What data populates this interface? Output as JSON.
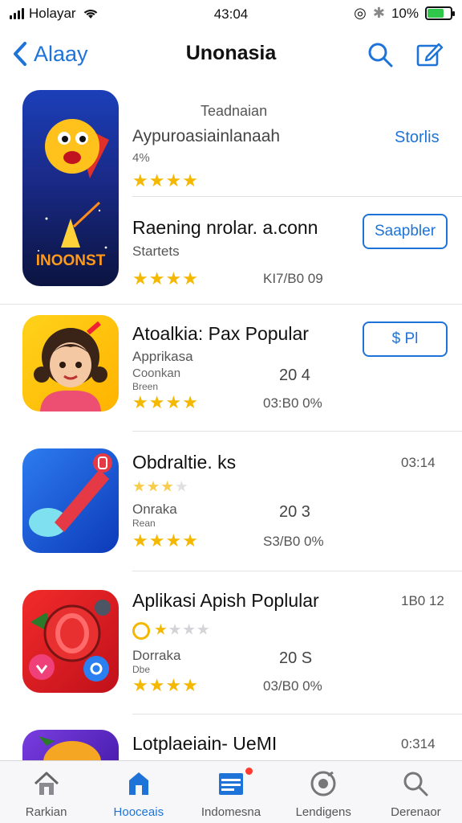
{
  "status_bar": {
    "carrier": "Holayar",
    "time": "43:04",
    "battery": "10%",
    "battery_level": 0.7
  },
  "nav": {
    "back_label": "Alaay",
    "title": "Unonasia",
    "search_icon": "search-icon",
    "edit_icon": "edit-icon"
  },
  "apps": [
    {
      "header": "Teadnaian",
      "title": "Aypuroasiainlanaah",
      "subtitle": "4%",
      "rating": 3.5,
      "action": "Storlis",
      "icon_text": ""
    },
    {
      "title": "Raening nrolar. a.conn",
      "subtitle": "Startets",
      "rating": 3.5,
      "meta": "KI7/B0 09",
      "button": "Saapbler",
      "icon_text": "INOONST"
    },
    {
      "title": "Atoalkia: Pax Popular",
      "subtitle": "Apprikasa",
      "small1": "Coonkan",
      "small2": "Breen",
      "number": "20 4",
      "rating": 3.5,
      "meta": "03:B0 0%",
      "button": "$ Pl"
    },
    {
      "title": "Obdraltie. ks",
      "right": "03:14",
      "stars_small": "3.0",
      "subtitle": "Onraka",
      "small1": "Rean",
      "number": "20 3",
      "rating": 3.5,
      "meta": "S3/B0 0%"
    },
    {
      "title": "Aplikasi Apish Poplular",
      "right": "1B0 12",
      "subtitle": "Dorraka",
      "small1": "Dbe",
      "number": "20 S",
      "rating": 3.5,
      "meta": "03/B0 0%"
    },
    {
      "title": "Lotplaeiain- UeMI",
      "right": "0:314"
    }
  ],
  "tabs": [
    {
      "label": "Rarkian",
      "icon": "home-icon",
      "active": false
    },
    {
      "label": "Hooceais",
      "icon": "featured-icon",
      "active": true
    },
    {
      "label": "Indomesna",
      "icon": "calendar-icon",
      "active": false,
      "badge": true
    },
    {
      "label": "Lendigens",
      "icon": "updates-icon",
      "active": false
    },
    {
      "label": "Derenaor",
      "icon": "search-icon",
      "active": false
    }
  ]
}
